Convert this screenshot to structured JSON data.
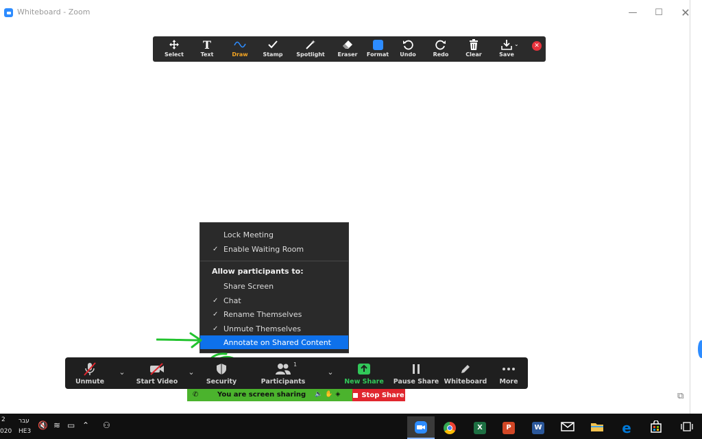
{
  "window": {
    "title": "Whiteboard - Zoom",
    "controls": {
      "minimize": "—",
      "maximize": "☐",
      "close": "✕"
    }
  },
  "annotation_toolbar": {
    "tools": [
      {
        "label": "Select",
        "icon": "move-icon"
      },
      {
        "label": "Text",
        "icon": "text-icon"
      },
      {
        "label": "Draw",
        "icon": "squiggle-icon",
        "active": true
      },
      {
        "label": "Stamp",
        "icon": "checkmark-icon"
      },
      {
        "label": "Spotlight",
        "icon": "wand-icon"
      },
      {
        "label": "Eraser",
        "icon": "eraser-icon"
      },
      {
        "label": "Format",
        "icon": "color-square-icon"
      },
      {
        "label": "Undo",
        "icon": "undo-icon"
      },
      {
        "label": "Redo",
        "icon": "redo-icon"
      },
      {
        "label": "Clear",
        "icon": "trash-icon"
      },
      {
        "label": "Save",
        "icon": "download-icon"
      }
    ],
    "close": "✕",
    "accent_color": "#f5a623",
    "format_color": "#2d8cff"
  },
  "security_menu": {
    "items": [
      {
        "label": "Lock Meeting",
        "checked": false
      },
      {
        "label": "Enable Waiting Room",
        "checked": true
      }
    ],
    "heading": "Allow participants to:",
    "allow": [
      {
        "label": "Share Screen",
        "checked": false
      },
      {
        "label": "Chat",
        "checked": true
      },
      {
        "label": "Rename Themselves",
        "checked": true
      },
      {
        "label": "Unmute Themselves",
        "checked": true
      },
      {
        "label": "Annotate on Shared Content",
        "checked": false,
        "highlighted": true
      }
    ],
    "check_glyph": "✓",
    "highlight_color": "#0e71eb"
  },
  "meeting_controls": {
    "unmute": "Unmute",
    "start_video": "Start Video",
    "security": "Security",
    "participants": "Participants",
    "participant_count": "1",
    "new_share": "New Share",
    "pause_share": "Pause Share",
    "whiteboard": "Whiteboard",
    "more": "More",
    "caret": "⌄"
  },
  "share_banner": {
    "text": "You are screen sharing",
    "stop": "Stop Share",
    "banner_color": "#4bb32d",
    "stop_color": "#e0262e"
  },
  "taskbar": {
    "date_fragment_top": "2",
    "date_fragment_bottom": "020",
    "lang_top": "עבר",
    "lang_bottom": "HE3",
    "apps": [
      {
        "name": "zoom-app",
        "letter": "",
        "color": "#2d8cff",
        "active": true
      },
      {
        "name": "chrome-app",
        "letter": "",
        "color": "#4285f4"
      },
      {
        "name": "excel-app",
        "letter": "X",
        "color": "#1d6f42"
      },
      {
        "name": "powerpoint-app",
        "letter": "P",
        "color": "#d24726"
      },
      {
        "name": "word-app",
        "letter": "W",
        "color": "#2b579a"
      },
      {
        "name": "mail-app",
        "letter": "",
        "color": "#ffffff"
      },
      {
        "name": "explorer-app",
        "letter": "",
        "color": "#f2c14e"
      },
      {
        "name": "edge-app",
        "letter": "e",
        "color": "#0078d7"
      },
      {
        "name": "store-app",
        "letter": "",
        "color": "#ffffff"
      },
      {
        "name": "taskview-app",
        "letter": "",
        "color": "#ffffff"
      }
    ]
  }
}
